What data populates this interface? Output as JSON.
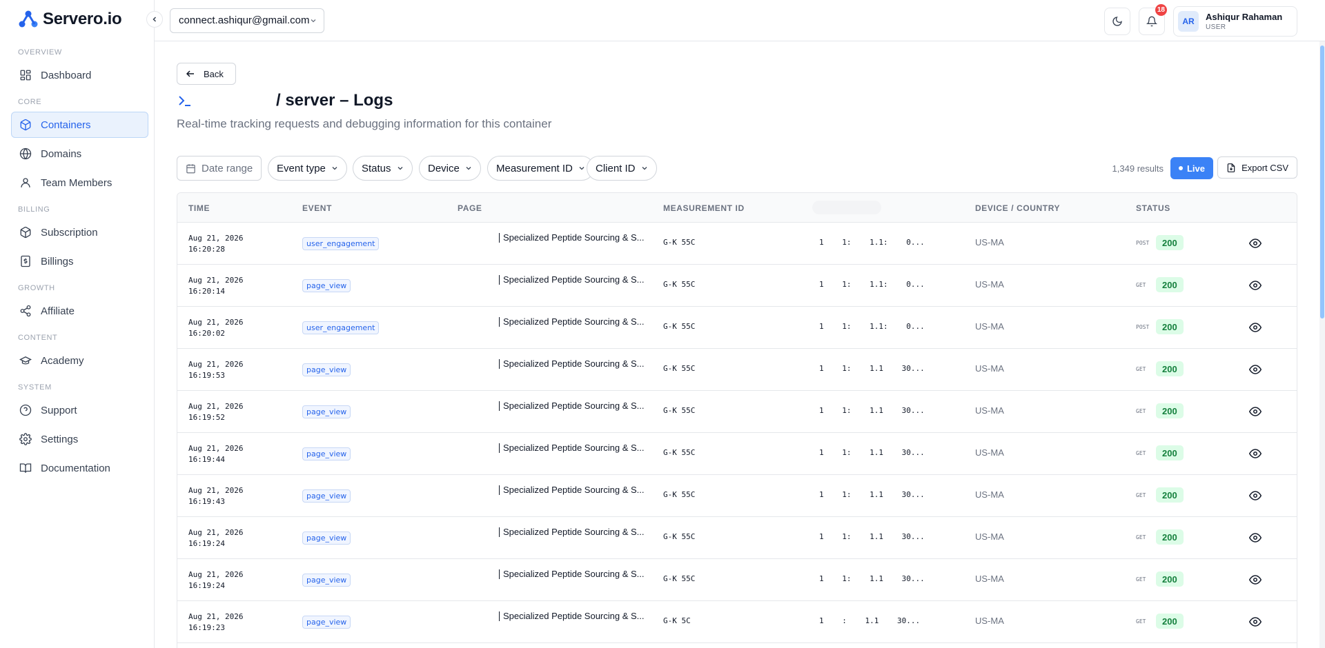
{
  "brand": {
    "name": "Servero.io"
  },
  "sidebar": {
    "sections": [
      {
        "label": "OVERVIEW",
        "items": [
          {
            "label": "Dashboard",
            "icon": "dashboard-icon"
          }
        ]
      },
      {
        "label": "CORE",
        "items": [
          {
            "label": "Containers",
            "icon": "box-icon",
            "active": true
          },
          {
            "label": "Domains",
            "icon": "globe-icon"
          },
          {
            "label": "Team Members",
            "icon": "user-icon"
          }
        ]
      },
      {
        "label": "BILLING",
        "items": [
          {
            "label": "Subscription",
            "icon": "box-icon"
          },
          {
            "label": "Billings",
            "icon": "billing-icon"
          }
        ]
      },
      {
        "label": "GROWTH",
        "items": [
          {
            "label": "Affiliate",
            "icon": "share-icon"
          }
        ]
      },
      {
        "label": "CONTENT",
        "items": [
          {
            "label": "Academy",
            "icon": "graduation-cap-icon"
          }
        ]
      },
      {
        "label": "SYSTEM",
        "items": [
          {
            "label": "Support",
            "icon": "help-icon"
          },
          {
            "label": "Settings",
            "icon": "gear-icon"
          },
          {
            "label": "Documentation",
            "icon": "book-icon"
          }
        ]
      }
    ]
  },
  "topbar": {
    "account": "connect.ashiqur@gmail.com",
    "notifications_count": "18",
    "user": {
      "initials": "AR",
      "name": "Ashiqur Rahaman",
      "role": "USER"
    }
  },
  "page": {
    "back_label": "Back",
    "title": "/ server – Logs",
    "subtitle": "Real-time tracking requests and debugging information for this container"
  },
  "filters": {
    "date_range": "Date range",
    "event_type": "Event type",
    "status": "Status",
    "device": "Device",
    "measurement_id": "Measurement ID",
    "client_id": "Client ID",
    "results": "1,349 results",
    "live": "Live",
    "export": "Export CSV"
  },
  "table": {
    "headers": {
      "time": "TIME",
      "event": "EVENT",
      "page": "PAGE",
      "measurement_id": "MEASUREMENT ID",
      "device": "DEVICE / COUNTRY",
      "status": "STATUS"
    },
    "rows": [
      {
        "date": "Aug 21, 2026",
        "time": "16:20:28",
        "event": "user_engagement",
        "page": "Specialized Peptide Sourcing & S...",
        "mid": "G-K    55C",
        "cid": "1 1: 1.1: 0...",
        "device": "US-MA",
        "method": "POST",
        "status": "200"
      },
      {
        "date": "Aug 21, 2026",
        "time": "16:20:14",
        "event": "page_view",
        "page": "Specialized Peptide Sourcing & S...",
        "mid": "G-K    55C",
        "cid": "1 1: 1.1: 0...",
        "device": "US-MA",
        "method": "GET",
        "status": "200"
      },
      {
        "date": "Aug 21, 2026",
        "time": "16:20:02",
        "event": "user_engagement",
        "page": "Specialized Peptide Sourcing & S...",
        "mid": "G-K    55C",
        "cid": "1 1: 1.1: 0...",
        "device": "US-MA",
        "method": "POST",
        "status": "200"
      },
      {
        "date": "Aug 21, 2026",
        "time": "16:19:53",
        "event": "page_view",
        "page": "Specialized Peptide Sourcing & S...",
        "mid": "G-K    55C",
        "cid": "1 1: 1.1 30...",
        "device": "US-MA",
        "method": "GET",
        "status": "200"
      },
      {
        "date": "Aug 21, 2026",
        "time": "16:19:52",
        "event": "page_view",
        "page": "Specialized Peptide Sourcing & S...",
        "mid": "G-K    55C",
        "cid": "1 1: 1.1 30...",
        "device": "US-MA",
        "method": "GET",
        "status": "200"
      },
      {
        "date": "Aug 21, 2026",
        "time": "16:19:44",
        "event": "page_view",
        "page": "Specialized Peptide Sourcing & S...",
        "mid": "G-K    55C",
        "cid": "1 1: 1.1 30...",
        "device": "US-MA",
        "method": "GET",
        "status": "200"
      },
      {
        "date": "Aug 21, 2026",
        "time": "16:19:43",
        "event": "page_view",
        "page": "Specialized Peptide Sourcing & S...",
        "mid": "G-K    55C",
        "cid": "1 1: 1.1 30...",
        "device": "US-MA",
        "method": "GET",
        "status": "200"
      },
      {
        "date": "Aug 21, 2026",
        "time": "16:19:24",
        "event": "page_view",
        "page": "Specialized Peptide Sourcing & S...",
        "mid": "G-K    55C",
        "cid": "1 1: 1.1 30...",
        "device": "US-MA",
        "method": "GET",
        "status": "200"
      },
      {
        "date": "Aug 21, 2026",
        "time": "16:19:24",
        "event": "page_view",
        "page": "Specialized Peptide Sourcing & S...",
        "mid": "G-K    55C",
        "cid": "1 1: 1.1 30...",
        "device": "US-MA",
        "method": "GET",
        "status": "200"
      },
      {
        "date": "Aug 21, 2026",
        "time": "16:19:23",
        "event": "page_view",
        "page": "Specialized Peptide Sourcing & S...",
        "mid": "G-K    5C",
        "cid": "1 : 1.1 30...",
        "device": "US-MA",
        "method": "GET",
        "status": "200"
      }
    ]
  },
  "colors": {
    "accent": "#3b82f6",
    "success_bg": "#dcfce7",
    "success_text": "#15803d",
    "badge": "#ef4444"
  }
}
